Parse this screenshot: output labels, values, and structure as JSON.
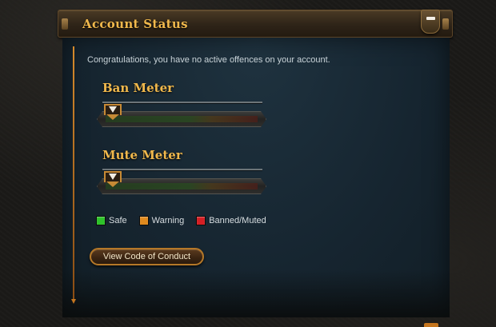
{
  "panel": {
    "title": "Account Status",
    "collapse_icon": "minus-icon"
  },
  "intro_text": "Congratulations, you have no active offences on your account.",
  "meters": [
    {
      "title": "Ban Meter",
      "level": 0
    },
    {
      "title": "Mute Meter",
      "level": 0
    }
  ],
  "legend": [
    {
      "label": "Safe",
      "color": "#2ec22a"
    },
    {
      "label": "Warning",
      "color": "#e08a1e"
    },
    {
      "label": "Banned/Muted",
      "color": "#d41f24"
    }
  ],
  "code_of_conduct_button": "View Code of Conduct",
  "colors": {
    "accent": "#f0b84c",
    "panel_bg": "#162530"
  }
}
